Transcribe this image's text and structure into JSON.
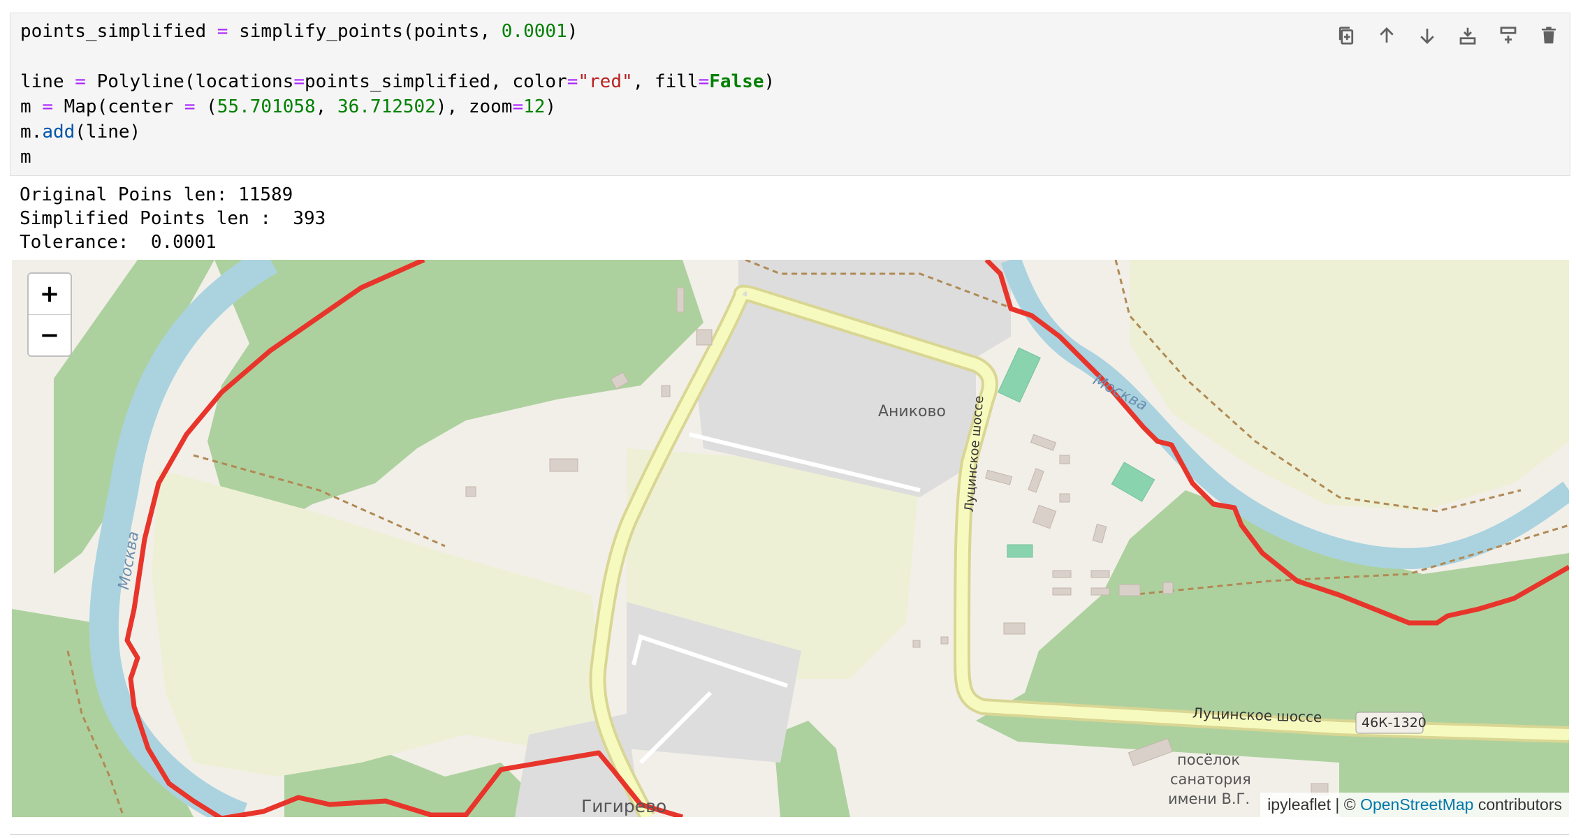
{
  "code_lines": {
    "l1": {
      "a": "points_simplified ",
      "op": "=",
      "b": " simplify_points(points, ",
      "num": "0.0001",
      "c": ")"
    },
    "l3": {
      "a": "line ",
      "op1": "=",
      "b": " Polyline(locations",
      "op2": "=",
      "c": "points_simplified, color",
      "op3": "=",
      "str": "\"red\"",
      "d": ", fill",
      "op4": "=",
      "kw": "False",
      "e": ")"
    },
    "l4": {
      "a": "m ",
      "op1": "=",
      "b": " Map(center ",
      "op2": "=",
      "c": " (",
      "n1": "55.701058",
      "d": ", ",
      "n2": "36.712502",
      "e": "), zoom",
      "op3": "=",
      "n3": "12",
      "f": ")"
    },
    "l5": {
      "a": "m.",
      "fn": "add",
      "b": "(line)"
    },
    "l6": {
      "a": "m"
    }
  },
  "toolbar": [
    {
      "name": "duplicate-cell-icon"
    },
    {
      "name": "move-up-icon"
    },
    {
      "name": "move-down-icon"
    },
    {
      "name": "insert-above-icon"
    },
    {
      "name": "insert-below-icon"
    },
    {
      "name": "delete-cell-icon"
    }
  ],
  "output": {
    "line1": "Original Poins len: 11589",
    "line2": "Simplified Points len :  393",
    "line3": "Tolerance:  0.0001"
  },
  "map": {
    "zoom_in": "+",
    "zoom_out": "−",
    "labels": {
      "anikovo": "Аниково",
      "moskva_left": "Москва",
      "moskva_right": "Москва",
      "lucinskoe_vertical": "Луцинское шоссе",
      "lucinskoe_horizontal": "Луцинское шоссе",
      "road_number": "46К-1320",
      "posyolok1": "посёлок",
      "posyolok2": "санатория",
      "posyolok3": "имени В.Г.",
      "gigirevo": "Гигирево"
    },
    "attribution": {
      "prefix": "ipyleaflet",
      "sep": " | © ",
      "link": "OpenStreetMap",
      "suffix": " contributors"
    },
    "colors": {
      "polyline": "#e8352b",
      "river": "#aad3df",
      "forest": "#add19e",
      "farmland": "#eef0d5",
      "land": "#f2efe9",
      "industrial": "#dddddd",
      "road": "#f7fabf"
    }
  }
}
